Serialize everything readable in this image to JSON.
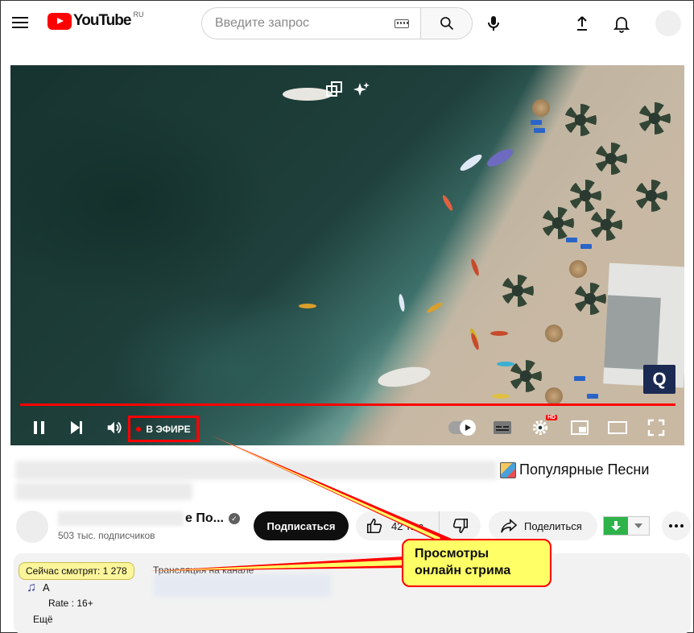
{
  "header": {
    "logo_text": "YouTube",
    "logo_country": "RU",
    "search_placeholder": "Введите запрос",
    "icons": [
      "menu-icon",
      "keyboard-icon",
      "search-icon",
      "mic-icon",
      "upload-icon",
      "bell-icon"
    ]
  },
  "player": {
    "live_label": "В ЭФИРЕ",
    "hd_label": "HD",
    "colors": {
      "progress": "#ff0000",
      "live_dot": "#ff0000"
    },
    "watermark": "Q"
  },
  "video": {
    "title_suffix": "Популярные Песни"
  },
  "channel": {
    "name": "е По...",
    "subscribers": "503 тыс. подписчиков",
    "subscribe_label": "Подписаться",
    "like_count": "42 тыс.",
    "share_label": "Поделиться"
  },
  "description": {
    "viewers": "Сейчас смотрят: 1 278",
    "line1": "Трансляция на канале",
    "line_a": "А",
    "rate": "Rate : 16+",
    "more": "Ещё"
  },
  "callout": {
    "text_line1": "Просмотры",
    "text_line2": "онлайн стрима"
  }
}
